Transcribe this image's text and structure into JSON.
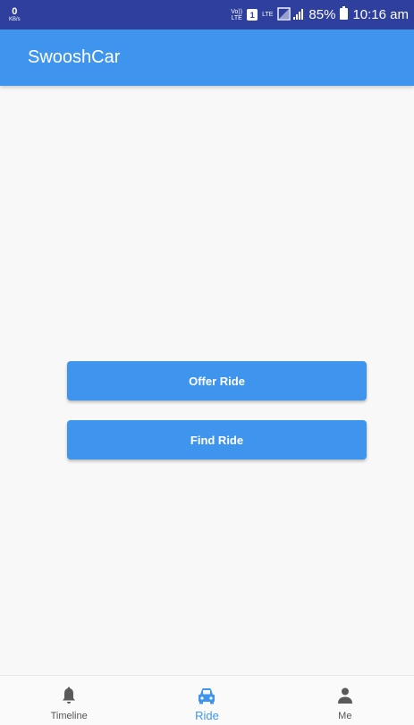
{
  "status_bar": {
    "speed_value": "0",
    "speed_unit": "KB/s",
    "volte": "Vo))\nLTE",
    "sim_number": "1",
    "network": "LTE",
    "battery": "85%",
    "time": "10:16 am"
  },
  "app_bar": {
    "title": "SwooshCar"
  },
  "buttons": {
    "offer": "Offer Ride",
    "find": "Find Ride"
  },
  "bottom_nav": [
    {
      "label": "Timeline",
      "icon": "bell-icon",
      "active": false
    },
    {
      "label": "Ride",
      "icon": "car-icon",
      "active": true
    },
    {
      "label": "Me",
      "icon": "person-icon",
      "active": false
    }
  ],
  "colors": {
    "primary": "#3f95ee",
    "status_bar": "#2e3f9e",
    "background": "#f8f8f8"
  }
}
